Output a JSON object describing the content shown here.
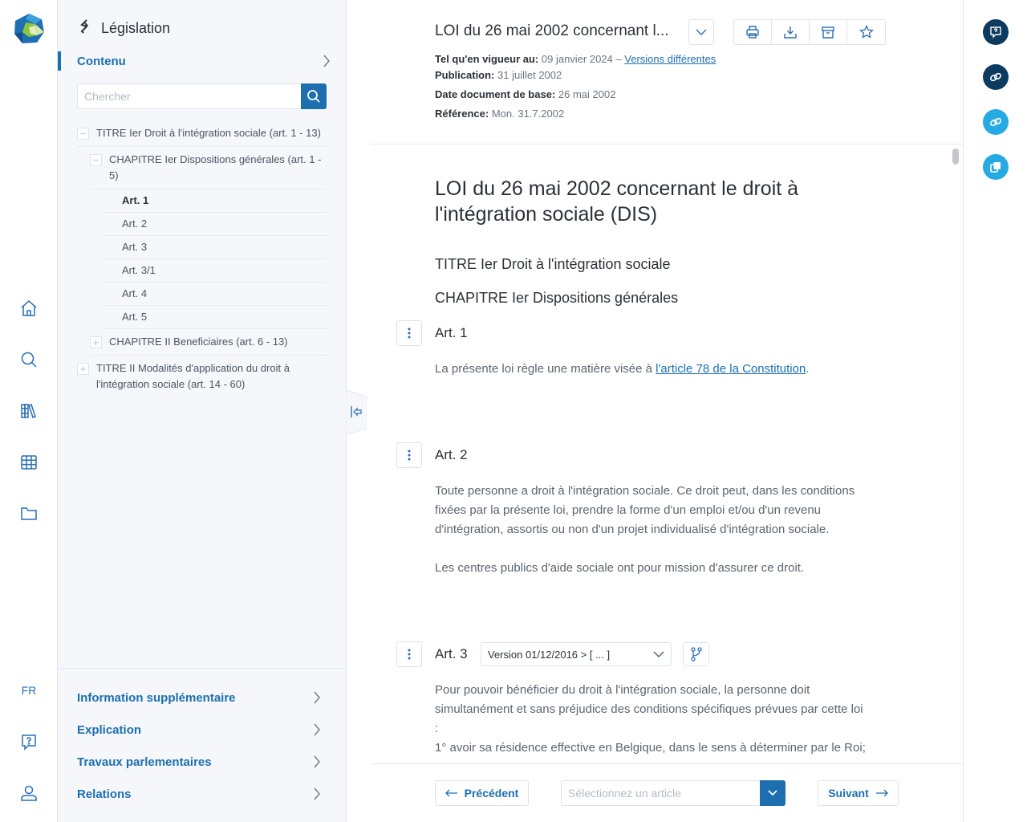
{
  "rail": {
    "language": "FR",
    "icons": [
      "home-icon",
      "search-icon",
      "library-icon",
      "table-icon",
      "folder-icon",
      "help-icon",
      "user-icon"
    ]
  },
  "sidebar": {
    "section_title": "Législation",
    "active_tab": "Contenu",
    "search_placeholder": "Chercher",
    "tree": [
      {
        "type": "titre",
        "label": "TITRE Ier Droit à l'intégration sociale (art. 1 - 13)",
        "expanded": true
      },
      {
        "type": "chapitre",
        "label": "CHAPITRE Ier Dispositions générales (art. 1 - 5)",
        "expanded": true
      },
      {
        "type": "article",
        "label": "Art. 1",
        "active": true
      },
      {
        "type": "article",
        "label": "Art. 2"
      },
      {
        "type": "article",
        "label": "Art. 3"
      },
      {
        "type": "article",
        "label": "Art. 3/1"
      },
      {
        "type": "article",
        "label": "Art. 4"
      },
      {
        "type": "article",
        "label": "Art. 5"
      },
      {
        "type": "chapitre",
        "label": "CHAPITRE II Beneficiaires (art. 6 - 13)",
        "expanded": false
      },
      {
        "type": "titre",
        "label": "TITRE II Modalités d'application du droit à l'intégration sociale (art. 14 - 60)",
        "expanded": false
      }
    ],
    "bottom_links": [
      "Information supplémentaire",
      "Explication",
      "Travaux parlementaires",
      "Relations"
    ]
  },
  "header": {
    "title": "LOI du 26 mai 2002 concernant l...",
    "meta": {
      "vigueur_label": "Tel qu'en vigueur au:",
      "vigueur_value": "09 janvier 2024 –",
      "versions_link": "Versions différentes",
      "publication_label": "Publication:",
      "publication_value": "31 juillet 2002",
      "date_base_label": "Date document de base:",
      "date_base_value": "26 mai 2002",
      "reference_label": "Référence:",
      "reference_value": "Mon. 31.7.2002"
    },
    "actions": [
      "print-icon",
      "download-icon",
      "archive-icon",
      "star-icon"
    ]
  },
  "content": {
    "heading": "LOI du 26 mai 2002 concernant le droit à l'intégration sociale (DIS)",
    "titre": "TITRE Ier Droit à l'intégration sociale",
    "chapitre": "CHAPITRE Ier Dispositions générales",
    "articles": [
      {
        "title": "Art. 1",
        "text_before": "La présente loi règle une matière visée à ",
        "link": "l'article 78 de la Constitution",
        "text_after": "."
      },
      {
        "title": "Art. 2",
        "paragraphs": [
          "Toute personne a droit à l'intégration sociale. Ce droit peut, dans les conditions fixées par la présente loi, prendre la forme d'un emploi et/ou d'un revenu d'intégration, assortis ou non d'un projet individualisé d'intégration sociale.",
          "Les centres publics d'aide sociale ont pour mission d'assurer ce droit."
        ]
      },
      {
        "title": "Art. 3",
        "version": "Version 01/12/2016 > [ ... ]",
        "paragraphs": [
          "Pour pouvoir bénéficier du droit à l'intégration sociale, la personne doit simultanément et sans préjudice des conditions spécifiques prévues par cette loi :",
          "1° avoir sa résidence effective en Belgique, dans le sens à déterminer par le Roi;"
        ]
      }
    ]
  },
  "footer": {
    "prev_label": "Précédent",
    "next_label": "Suivant",
    "select_placeholder": "Sélectionnez un article"
  },
  "colors": {
    "primary": "#1d6fb0",
    "dark_navy": "#0d3a5f",
    "light_blue": "#27a9e1",
    "sidebar_bg": "#f5f7fa"
  }
}
